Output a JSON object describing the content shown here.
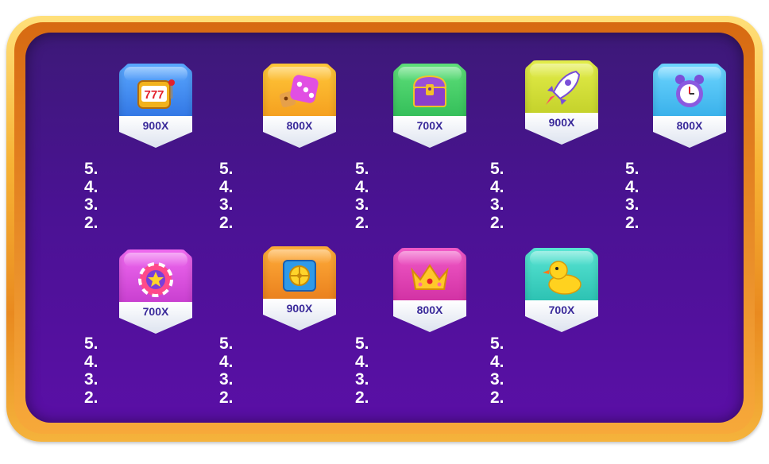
{
  "colors": {
    "panel_top": "#3d1978",
    "panel_bottom": "#5a0fa6",
    "frame_gold": "#f7b234",
    "multiplier_text": "#3a2a9a",
    "pay_text": "#ffffff"
  },
  "symbols": [
    {
      "icon": "slot-machine-777-icon",
      "color": "#2d7df0",
      "multiplier": "900X",
      "pays": [
        "5.",
        "4.",
        "3.",
        "2."
      ]
    },
    {
      "icon": "dice-icon",
      "color": "#f5a51f",
      "multiplier": "800X",
      "pays": [
        "5.",
        "4.",
        "3.",
        "2."
      ]
    },
    {
      "icon": "treasure-chest-icon",
      "color": "#33c75a",
      "multiplier": "700X",
      "pays": [
        "5.",
        "4.",
        "3.",
        "2."
      ]
    },
    {
      "icon": "rocket-icon",
      "color": "#c8d42a",
      "multiplier": "900X",
      "pays": [
        "5.",
        "4.",
        "3.",
        "2."
      ]
    },
    {
      "icon": "alarm-clock-icon",
      "color": "#39b9f0",
      "multiplier": "800X",
      "pays": [
        "5.",
        "4.",
        "3.",
        "2."
      ]
    },
    {
      "icon": "star-chip-icon",
      "color": "#d63ad8",
      "multiplier": "700X",
      "pays": [
        "5.",
        "4.",
        "3.",
        "2."
      ]
    },
    {
      "icon": "safe-icon",
      "color": "#f58a1f",
      "multiplier": "900X",
      "pays": [
        "5.",
        "4.",
        "3.",
        "2."
      ]
    },
    {
      "icon": "crown-icon",
      "color": "#e23cb0",
      "multiplier": "800X",
      "pays": [
        "5.",
        "4.",
        "3.",
        "2."
      ]
    },
    {
      "icon": "rubber-duck-icon",
      "color": "#2fcfc0",
      "multiplier": "700X",
      "pays": [
        "5.",
        "4.",
        "3.",
        "2."
      ]
    }
  ]
}
